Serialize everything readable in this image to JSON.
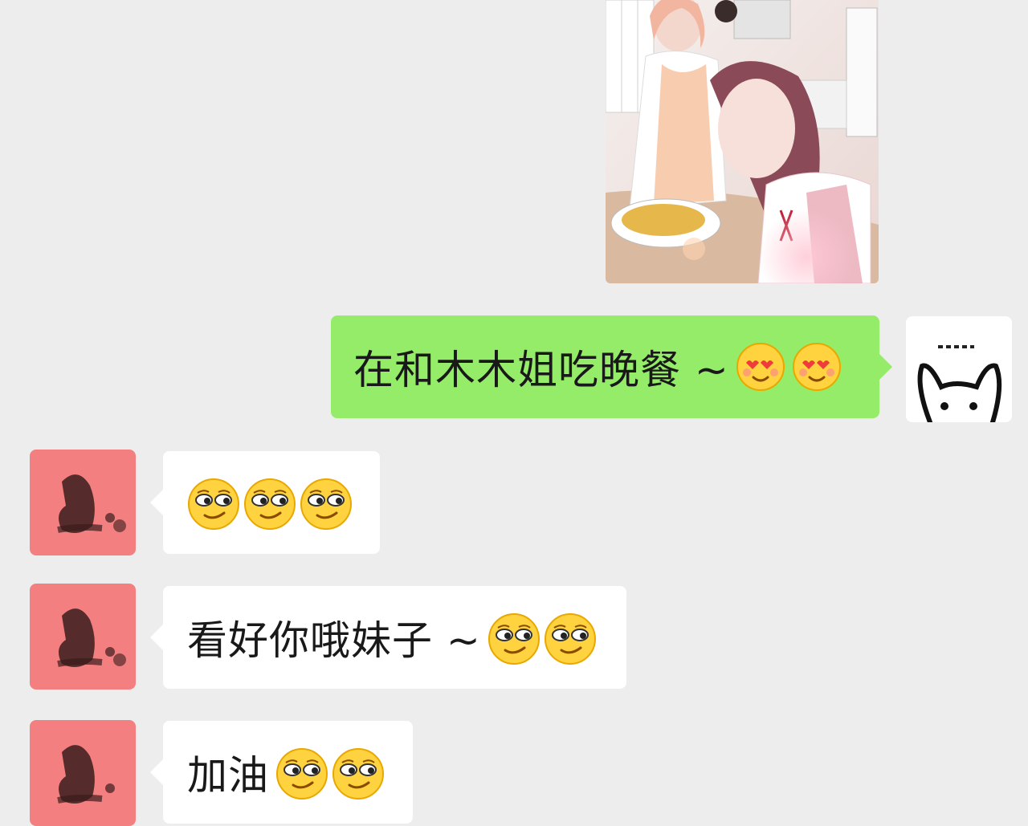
{
  "conversation": {
    "messages": [
      {
        "sender": "me",
        "type": "image",
        "alt_icon": "dinner-photo"
      },
      {
        "sender": "me",
        "type": "text",
        "text": "在和木木姐吃晚餐 ~",
        "emojis": [
          "heart-eyes-emoji",
          "heart-eyes-emoji"
        ]
      },
      {
        "sender": "other",
        "type": "text",
        "text": "",
        "emojis": [
          "smirk-emoji",
          "smirk-emoji",
          "smirk-emoji"
        ]
      },
      {
        "sender": "other",
        "type": "text",
        "text": "看好你哦妹子 ~",
        "emojis": [
          "smirk-emoji",
          "smirk-emoji"
        ]
      },
      {
        "sender": "other",
        "type": "text",
        "text": "加油",
        "emojis": [
          "smirk-emoji",
          "smirk-emoji"
        ]
      }
    ]
  },
  "avatars": {
    "me": {
      "icon": "bunny-icon",
      "background": "#ffffff"
    },
    "other": {
      "icon": "ink-figure-icon",
      "background": "#f47f80"
    }
  },
  "colors": {
    "background": "#ededed",
    "my_bubble": "#95ec69",
    "other_bubble": "#ffffff",
    "text": "#191919"
  }
}
